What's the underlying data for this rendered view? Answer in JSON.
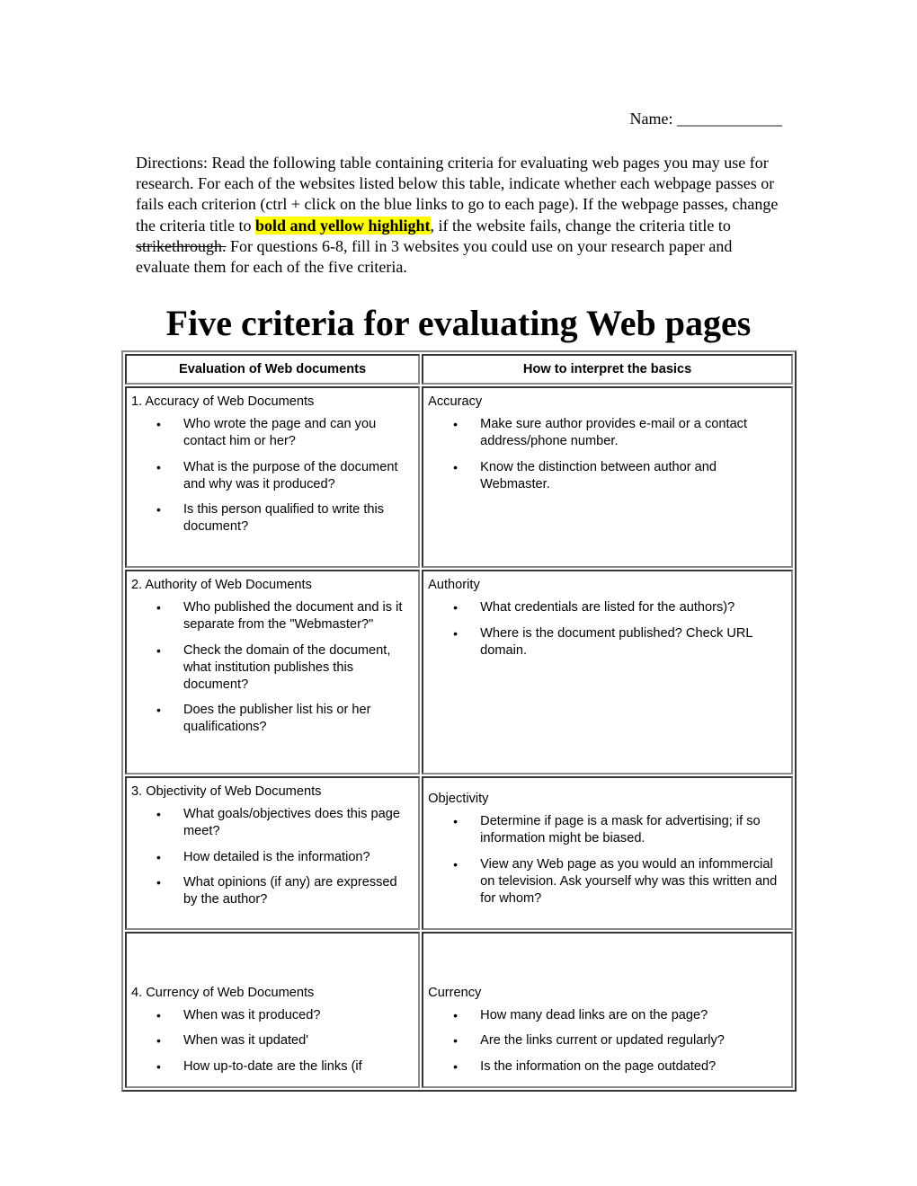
{
  "header": {
    "name_label": "Name: _____________"
  },
  "directions": {
    "part1": "Directions: Read the following table containing criteria for evaluating web pages you may use for research.  For each of the websites listed below this table, indicate whether each webpage passes or fails each criterion (ctrl + click on the blue links to go to each page).  If the webpage passes, change the criteria title to ",
    "highlight": "bold and yellow highlight",
    "part2": ", if the website fails, change the criteria title to ",
    "strike": "strikethrough.",
    "part3": "  For questions 6-8, fill in 3 websites you could use on your research paper and evaluate them for each of the five criteria."
  },
  "title": "Five criteria for evaluating Web pages",
  "table": {
    "headers": [
      "Evaluation of Web documents",
      "How to interpret the basics"
    ],
    "rows": [
      {
        "left_title": "1. Accuracy of Web Documents",
        "left_points": [
          "Who wrote the page and can you contact him or her?",
          "What is the purpose of the document and why was it produced?",
          "Is this person qualified to write this document?"
        ],
        "right_title": "Accuracy",
        "right_points": [
          "Make sure author provides e-mail or a contact address/phone number.",
          "Know the distinction between author and Webmaster."
        ]
      },
      {
        "left_title": "2. Authority of Web Documents",
        "left_points": [
          "Who published the document and is it separate from the \"Webmaster?\"",
          "Check the domain of the document, what institution publishes this document?",
          "Does the publisher list his or her qualifications?"
        ],
        "right_title": "Authority",
        "right_points": [
          "What credentials are listed for the authors)?",
          "Where is the document published? Check URL domain."
        ]
      },
      {
        "left_title": "3. Objectivity of Web Documents",
        "left_points": [
          "What goals/objectives does this page meet?",
          "How detailed is the information?",
          "What opinions (if any) are expressed by the author?"
        ],
        "right_title": "Objectivity",
        "right_points": [
          "Determine if page is a mask for advertising; if so information might be biased.",
          "View any Web page as you would an infommercial on television. Ask yourself why was this written and for whom?"
        ]
      },
      {
        "left_title": "4. Currency of Web Documents",
        "left_points": [
          "When was it produced?",
          "When was it updated'",
          "How up-to-date are the links (if"
        ],
        "right_title": "Currency",
        "right_points": [
          "How many dead links are on the page?",
          "Are the links current or updated regularly?",
          "Is the information on the page outdated?"
        ]
      }
    ],
    "bullet_glyph": "•"
  }
}
